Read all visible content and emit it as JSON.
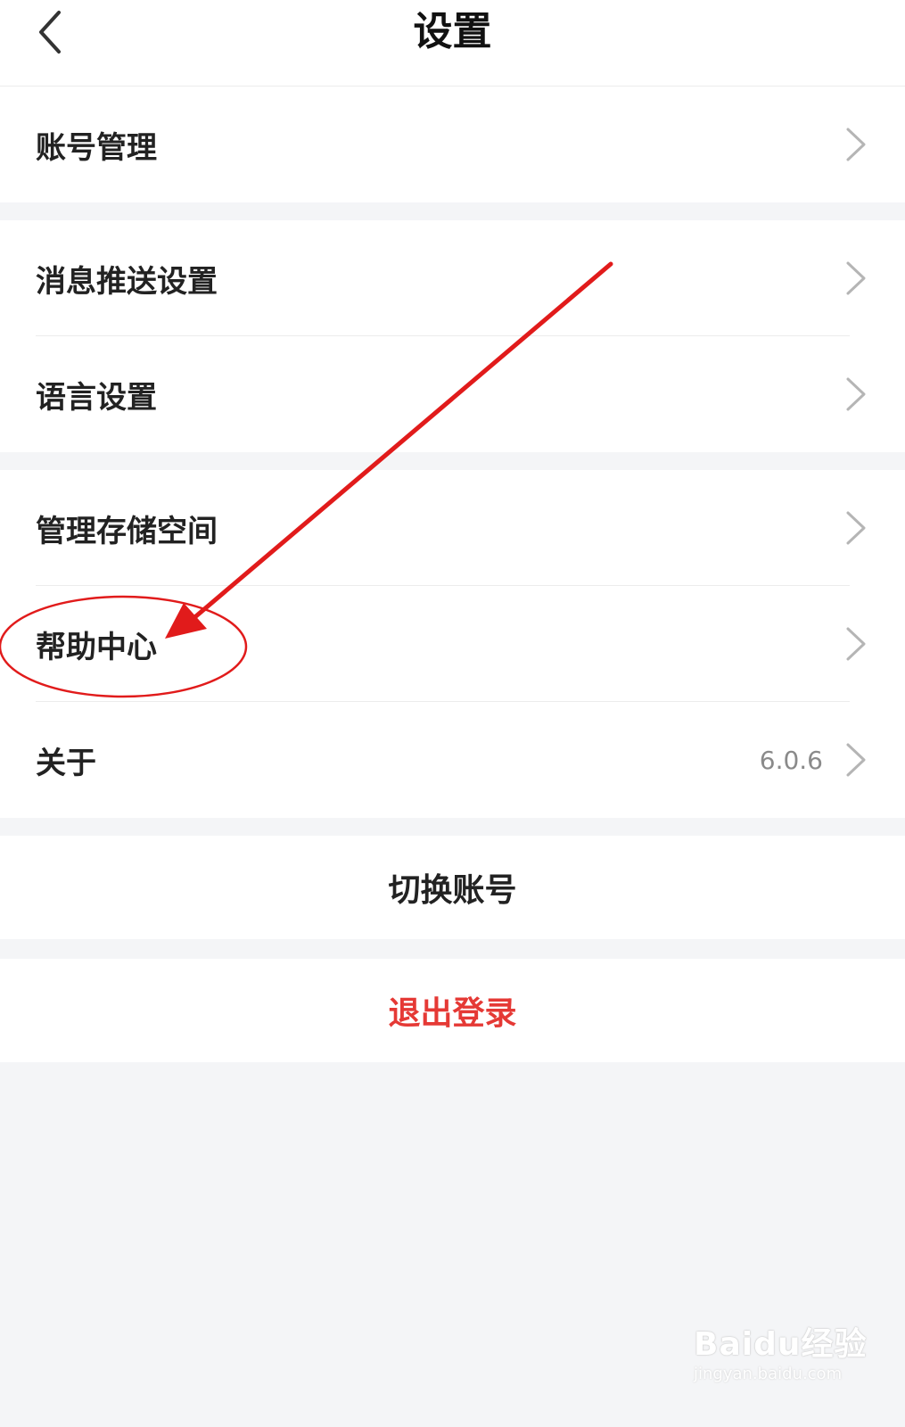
{
  "header": {
    "title": "设置",
    "back_icon": "chevron-left-icon"
  },
  "groups": [
    {
      "items": [
        {
          "label": "账号管理",
          "value": "",
          "icon": "chevron-right-icon"
        }
      ]
    },
    {
      "items": [
        {
          "label": "消息推送设置",
          "value": "",
          "icon": "chevron-right-icon"
        },
        {
          "label": "语言设置",
          "value": "",
          "icon": "chevron-right-icon"
        }
      ]
    },
    {
      "items": [
        {
          "label": "管理存储空间",
          "value": "",
          "icon": "chevron-right-icon"
        },
        {
          "label": "帮助中心",
          "value": "",
          "icon": "chevron-right-icon"
        },
        {
          "label": "关于",
          "value": "6.0.6",
          "icon": "chevron-right-icon"
        }
      ]
    }
  ],
  "actions": {
    "switch_account": "切换账号",
    "logout": "退出登录"
  },
  "colors": {
    "page_background": "#f4f5f7",
    "card_background": "#ffffff",
    "text_primary": "#222222",
    "text_secondary": "#8a8a8a",
    "logout_red": "#e53935",
    "annotation_red": "#e11b1b"
  },
  "watermark": {
    "brand": "Baidu经验",
    "url": "jingyan.baidu.com"
  }
}
